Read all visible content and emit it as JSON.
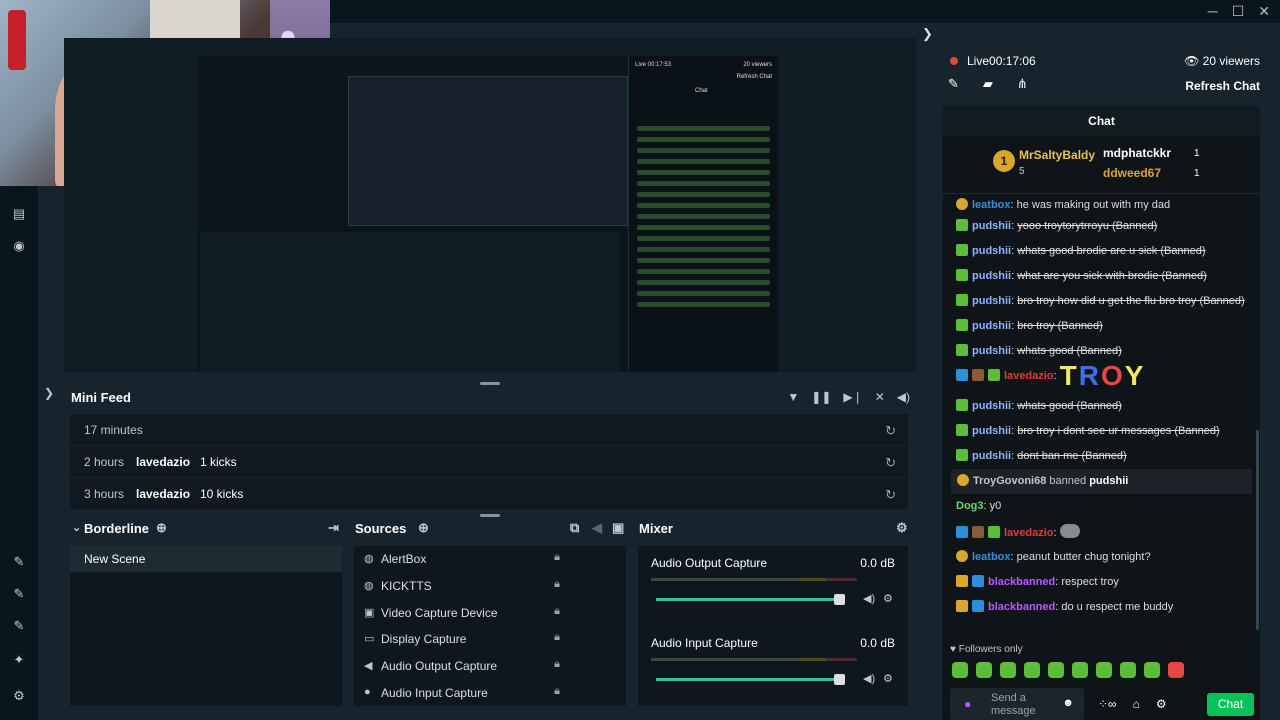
{
  "window": {
    "minimize": "─",
    "maximize": "☐",
    "close": "✕"
  },
  "editor": {
    "preview_live_text": "Live 00:17:53",
    "preview_viewers": "20 viewers",
    "preview_refresh": "Refresh Chat",
    "preview_chat": "Chat"
  },
  "minifeed": {
    "title": "Mini Feed",
    "rows": [
      {
        "time": "17 minutes",
        "user": "",
        "action": ""
      },
      {
        "time": "2 hours",
        "user": "lavedazio",
        "action": "1 kicks"
      },
      {
        "time": "3 hours",
        "user": "lavedazio",
        "action": "10 kicks"
      }
    ]
  },
  "scenes": {
    "title": "Borderline",
    "items": [
      "New Scene"
    ]
  },
  "sources": {
    "title": "Sources",
    "items": [
      {
        "name": "AlertBox",
        "icon": "globe-icon"
      },
      {
        "name": "KICKTTS",
        "icon": "globe-icon"
      },
      {
        "name": "Video Capture Device",
        "icon": "camera-icon"
      },
      {
        "name": "Display Capture",
        "icon": "monitor-icon"
      },
      {
        "name": "Audio Output Capture",
        "icon": "speaker-icon"
      },
      {
        "name": "Audio Input Capture",
        "icon": "mic-icon"
      }
    ]
  },
  "mixer": {
    "title": "Mixer",
    "items": [
      {
        "name": "Audio Output Capture",
        "db": "0.0 dB",
        "level": 1.0
      },
      {
        "name": "Audio Input Capture",
        "db": "0.0 dB",
        "level": 1.0
      }
    ]
  },
  "live": {
    "status": "Live",
    "time": "00:17:06",
    "viewers": "20 viewers",
    "refresh": "Refresh Chat"
  },
  "chat": {
    "title": "Chat",
    "top": {
      "rank": "1",
      "name": "MrSaltyBaldy",
      "count": "5",
      "second": "mdphatckkr",
      "second_count": "1",
      "third": "ddweed67",
      "third_count": "1"
    },
    "messages": [
      {
        "user": "leatbox",
        "text": "he was making out with my dad",
        "color": "blue2",
        "strike": false
      },
      {
        "user": "pudshii",
        "text": "yooo troytorytrroyu (Banned)",
        "color": "",
        "strike": true
      },
      {
        "user": "pudshii",
        "text": "whats good brodie are u sick (Banned)",
        "color": "",
        "strike": true
      },
      {
        "user": "pudshii",
        "text": "what are you sick with brodie (Banned)",
        "color": "",
        "strike": true
      },
      {
        "user": "pudshii",
        "text": "bro troy how did u get the flu bro troy (Banned)",
        "color": "",
        "strike": true
      },
      {
        "user": "pudshii",
        "text": "bro troy (Banned)",
        "color": "",
        "strike": true
      },
      {
        "user": "pudshii",
        "text": "whats good (Banned)",
        "color": "",
        "strike": true
      },
      {
        "user": "lavedazio",
        "text": "TROY",
        "color": "red",
        "strike": false
      },
      {
        "user": "pudshii",
        "text": "whats good (Banned)",
        "color": "",
        "strike": true
      },
      {
        "user": "pudshii",
        "text": "bro troy i dont see ur messages (Banned)",
        "color": "",
        "strike": true
      },
      {
        "user": "pudshii",
        "text": "dont ban me (Banned)",
        "color": "",
        "strike": true
      }
    ],
    "ban_notice": {
      "actor": "TroyGovoni68",
      "verb": "banned",
      "target": "pudshii"
    },
    "messages2": [
      {
        "user": "Dog3",
        "text": "y0",
        "color": "green"
      },
      {
        "user": "lavedazio",
        "text": "",
        "color": "red"
      },
      {
        "user": "leatbox",
        "text": "peanut butter chug tonight?",
        "color": "blue2"
      },
      {
        "user": "blackbanned",
        "text": "respect troy",
        "color": "purple"
      },
      {
        "user": "blackbanned",
        "text": "do u respect me buddy",
        "color": "purple"
      }
    ],
    "followers_only": "Followers only",
    "input_placeholder": "Send a message",
    "send_label": "Chat"
  },
  "colors": {
    "accent": "#31c3a2",
    "live": "#eb4537",
    "send": "#09c15b",
    "gold": "#d9a72c"
  }
}
